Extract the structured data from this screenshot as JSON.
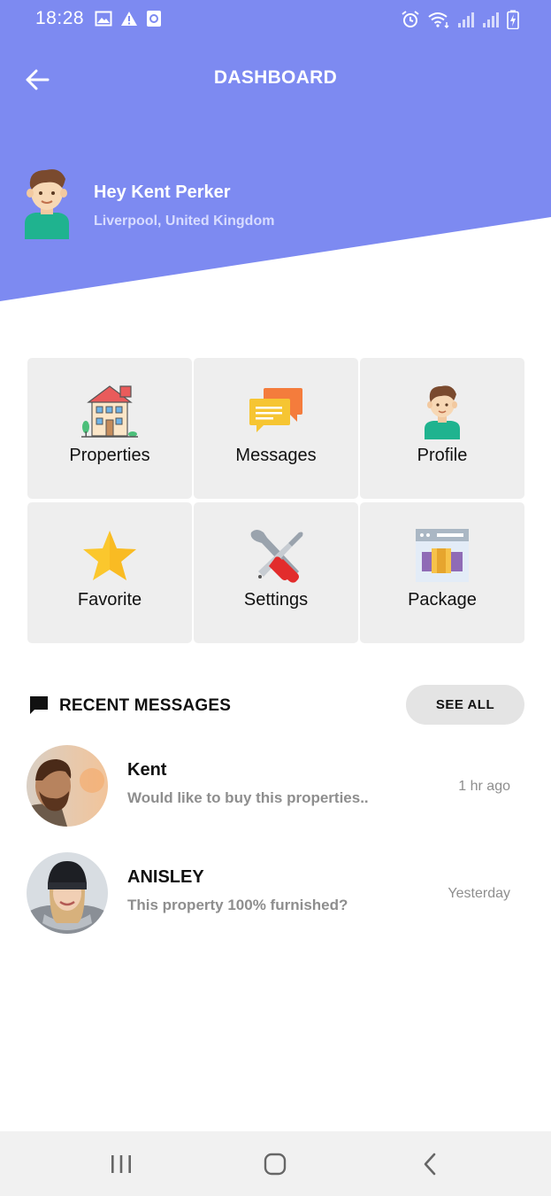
{
  "colors": {
    "header_bg": "#7d8af1",
    "tile_bg": "#eeeeee",
    "muted_text": "#8e8e8e",
    "see_all_bg": "#e4e4e4"
  },
  "status_bar": {
    "time": "18:28",
    "left_icons": [
      "image-icon",
      "warning-icon",
      "notification-icon"
    ],
    "right_icons": [
      "alarm-icon",
      "wifi-icon",
      "signal-icon",
      "signal-icon",
      "battery-charging-icon"
    ]
  },
  "header": {
    "title": "DASHBOARD",
    "back_icon": "arrow-left-icon"
  },
  "user": {
    "greeting": "Hey Kent Perker",
    "location": "Liverpool, United Kingdom",
    "avatar_icon": "boy-avatar-icon"
  },
  "tiles": [
    {
      "label": "Properties",
      "icon": "house-icon"
    },
    {
      "label": "Messages",
      "icon": "chat-bubbles-icon"
    },
    {
      "label": "Profile",
      "icon": "profile-avatar-icon"
    },
    {
      "label": "Favorite",
      "icon": "star-icon"
    },
    {
      "label": "Settings",
      "icon": "tools-icon"
    },
    {
      "label": "Package",
      "icon": "package-icon"
    }
  ],
  "recent": {
    "title": "RECENT MESSAGES",
    "see_all": "SEE ALL",
    "messages": [
      {
        "name": "Kent",
        "text": "Would like to buy this properties..",
        "time": "1 hr ago"
      },
      {
        "name": "ANISLEY",
        "text": "This property 100% furnished?",
        "time": "Yesterday"
      }
    ]
  },
  "nav": [
    "recent-apps-icon",
    "home-icon",
    "back-icon"
  ]
}
